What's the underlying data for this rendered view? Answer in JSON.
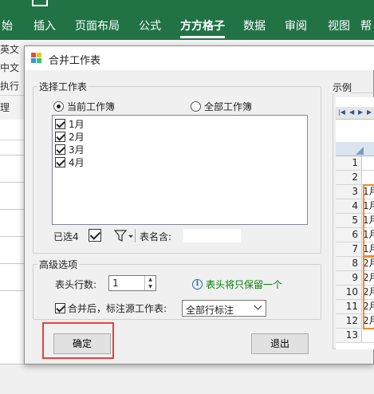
{
  "ribbon": {
    "tabs": [
      {
        "label": "始",
        "active": false
      },
      {
        "label": "插入",
        "active": false
      },
      {
        "label": "页面布局",
        "active": false
      },
      {
        "label": "公式",
        "active": false
      },
      {
        "label": "方方格子",
        "active": true
      },
      {
        "label": "数据",
        "active": false
      },
      {
        "label": "审阅",
        "active": false
      },
      {
        "label": "视图",
        "active": false
      },
      {
        "label": "帮",
        "active": false
      }
    ],
    "left_commands": [
      "英文",
      "中文",
      "执行",
      "理"
    ]
  },
  "dialog": {
    "title": "合并工作表",
    "select_group": {
      "label": "选择工作表",
      "radio_current": "当前工作簿",
      "radio_all": "全部工作簿",
      "selected_radio": "current",
      "sheets": [
        {
          "label": "1月",
          "checked": true
        },
        {
          "label": "2月",
          "checked": true
        },
        {
          "label": "3月",
          "checked": true
        },
        {
          "label": "4月",
          "checked": true
        }
      ],
      "selected_count": "已选4",
      "name_contains_label": "表名含:"
    },
    "advanced_group": {
      "label": "高级选项",
      "header_rows_label": "表头行数:",
      "header_rows_value": "1",
      "info_text": "表头将只保留一个",
      "merge_label": "合并后，标注源工作表:",
      "merge_checked": true,
      "mark_option": "全部行标注"
    },
    "buttons": {
      "ok": "确定",
      "exit": "退出"
    },
    "preview": {
      "label": "示例",
      "rows": [
        {
          "num": "1",
          "cell": ""
        },
        {
          "num": "2",
          "cell": ""
        },
        {
          "num": "3",
          "cell": "1月"
        },
        {
          "num": "4",
          "cell": "1月"
        },
        {
          "num": "5",
          "cell": "1月"
        },
        {
          "num": "6",
          "cell": "1月"
        },
        {
          "num": "7",
          "cell": "1月"
        },
        {
          "num": "8",
          "cell": "2月"
        },
        {
          "num": "9",
          "cell": "2月"
        },
        {
          "num": "10",
          "cell": "2月"
        },
        {
          "num": "11",
          "cell": "2月"
        },
        {
          "num": "12",
          "cell": "2月"
        },
        {
          "num": "13",
          "cell": ""
        }
      ]
    }
  },
  "colors": {
    "ribbon": "#217346",
    "info_text": "#008000",
    "highlight": "#e8413b",
    "preview_box": "#f18a2a"
  }
}
